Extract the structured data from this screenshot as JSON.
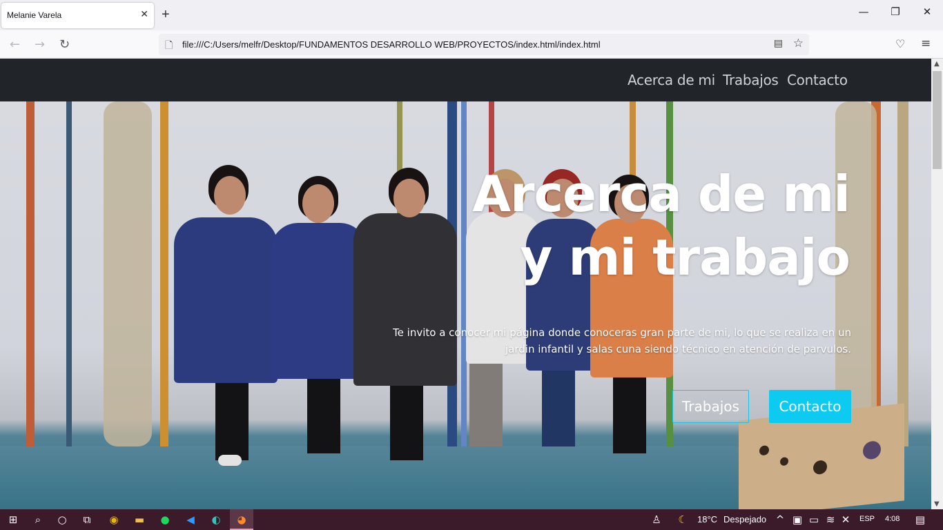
{
  "browser": {
    "tab_title": "Melanie Varela",
    "url": "file:///C:/Users/melfr/Desktop/FUNDAMENTOS DESARROLLO WEB/PROYECTOS/index.html/index.html"
  },
  "site": {
    "nav": {
      "about": "Acerca de mi",
      "work": "Trabajos",
      "contact": "Contacto"
    },
    "hero": {
      "title_line1": "Arcerca de mi",
      "title_line2": "y mi trabajo",
      "text_line1": "Te invito a conocer mi página donde conoceras gran parte de mi, lo que se realiza en un",
      "text_line2": "jardin infantil y salas cuna siendo técnico en atención de parvulos.",
      "button_work": "Trabajos",
      "button_contact": "Contacto"
    },
    "colors": {
      "navbar": "#212529",
      "accent": "#0dcaf0"
    }
  },
  "taskbar": {
    "weather_temp": "18°C",
    "weather_desc": "Despejado",
    "language": "ESP",
    "time": "4:08"
  }
}
